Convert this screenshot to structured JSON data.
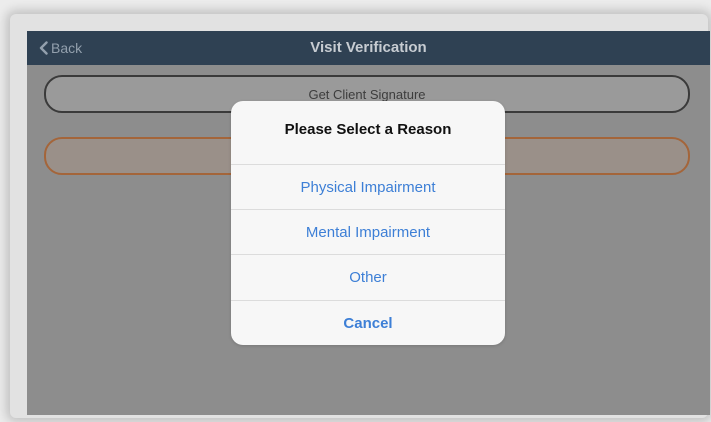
{
  "navbar": {
    "back_label": "Back",
    "title": "Visit Verification"
  },
  "main": {
    "signature_button_label": "Get Client Signature",
    "reason_field_value": ""
  },
  "dialog": {
    "title": "Please Select a Reason",
    "options": [
      {
        "label": "Physical Impairment"
      },
      {
        "label": "Mental Impairment"
      },
      {
        "label": "Other"
      }
    ],
    "cancel_label": "Cancel"
  },
  "colors": {
    "navbar": "#2f4153",
    "option_text": "#3d7fd6",
    "reason_border": "#a4653a"
  }
}
